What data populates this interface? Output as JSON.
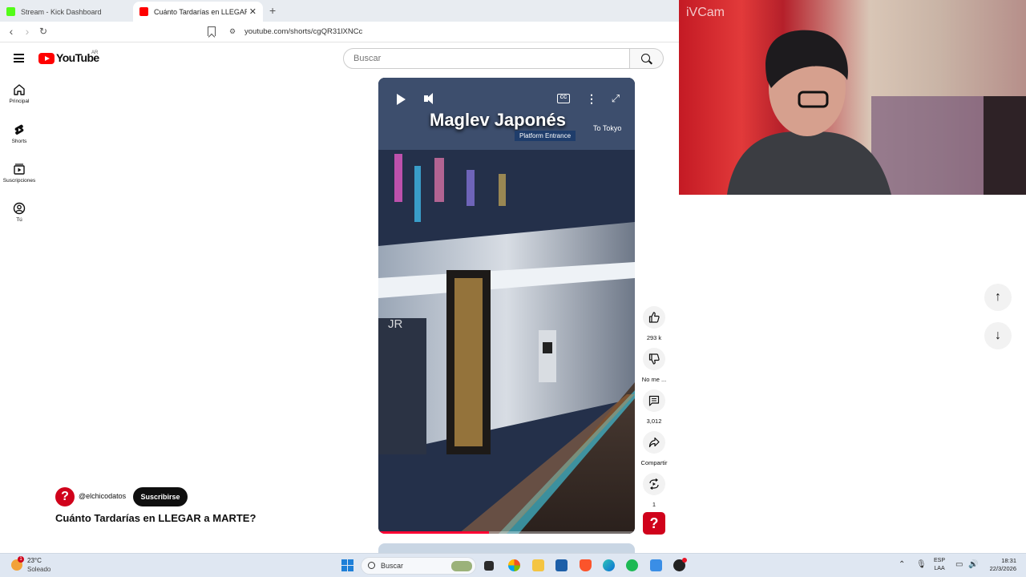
{
  "browser": {
    "tabs": [
      {
        "label": "Stream - Kick Dashboard",
        "active": false,
        "favicon_color": "#53fc18"
      },
      {
        "label": "Cuánto Tardarías en LLEGAR a M",
        "active": true,
        "favicon_color": "#ff0000"
      }
    ],
    "new_tab_label": "+",
    "close_label": "✕",
    "url": "youtube.com/shorts/cgQR31lXNCc"
  },
  "youtube": {
    "logo_text": "YouTube",
    "country_code": "AR",
    "search_placeholder": "Buscar",
    "nav": [
      {
        "label": "Principal",
        "icon": "home-icon"
      },
      {
        "label": "Shorts",
        "icon": "shorts-icon"
      },
      {
        "label": "Suscripciones",
        "icon": "subscriptions-icon"
      },
      {
        "label": "Tú",
        "icon": "you-icon"
      }
    ],
    "short": {
      "overlay_title": "Maglev Japonés",
      "overlay_sign": "Platform Entrance",
      "overlay_sign2": "To Tokyo",
      "cc_label": "CC",
      "progress_fraction": 0.43,
      "channel_handle": "@elchicodatos",
      "subscribe_label": "Suscribirse",
      "title": "Cuánto Tardarías en LLEGAR a MARTE?"
    },
    "actions": [
      {
        "name": "like",
        "icon": "thumbs-up-icon",
        "label": "293 k"
      },
      {
        "name": "dislike",
        "icon": "thumbs-down-icon",
        "label": "No me ..."
      },
      {
        "name": "comments",
        "icon": "comment-icon",
        "label": "3,012"
      },
      {
        "name": "share",
        "icon": "share-icon",
        "label": "Compartir"
      },
      {
        "name": "remix",
        "icon": "remix-icon",
        "label": "1"
      }
    ],
    "nav_arrows": {
      "up": "↑",
      "down": "↓"
    }
  },
  "webcam": {
    "label": "iVCam"
  },
  "taskbar": {
    "weather_temp": "23°C",
    "weather_desc": "Soleado",
    "weather_badge": "1",
    "search_label": "Buscar",
    "lang_line1": "ESP",
    "lang_line2": "LAA",
    "time": "18:31",
    "date": "22/3/2026"
  }
}
